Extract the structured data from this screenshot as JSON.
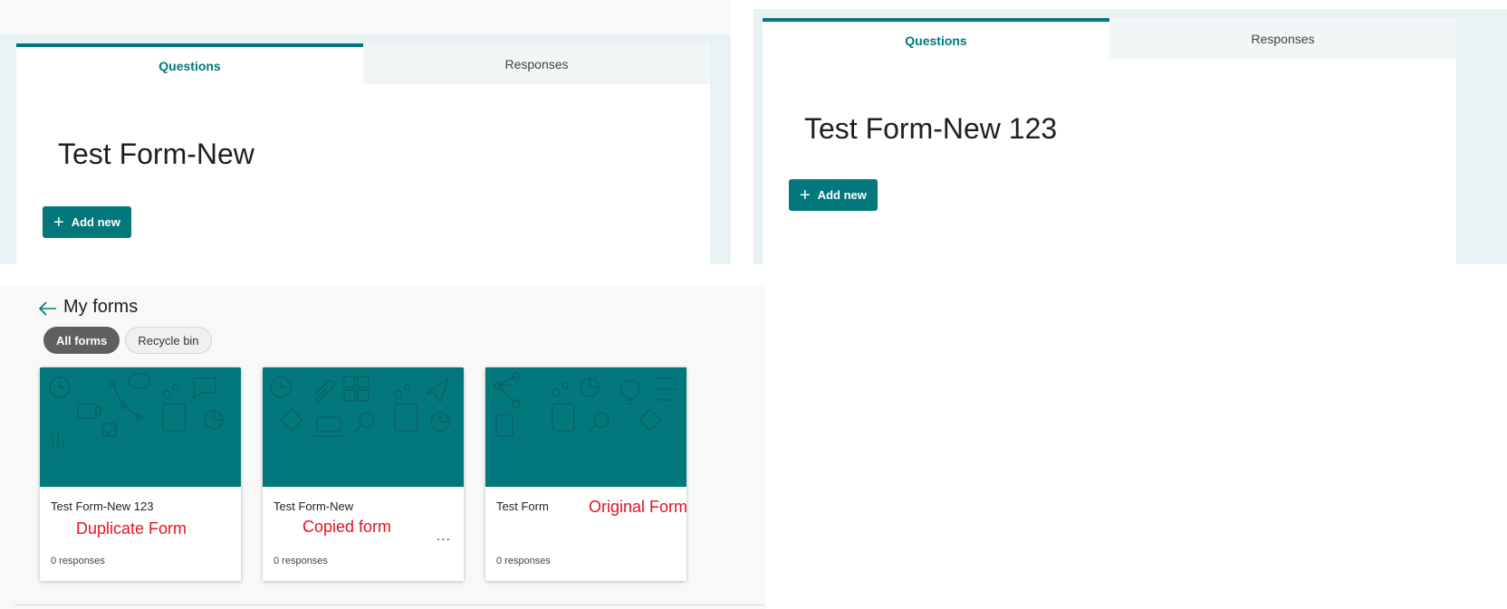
{
  "editor_left": {
    "tabs": [
      {
        "label": "Questions",
        "active": true
      },
      {
        "label": "Responses",
        "active": false
      }
    ],
    "form_title": "Test Form-New",
    "add_new_label": "Add new"
  },
  "editor_right": {
    "tabs": [
      {
        "label": "Questions",
        "active": true
      },
      {
        "label": "Responses",
        "active": false
      }
    ],
    "form_title": "Test Form-New 123",
    "add_new_label": "Add new"
  },
  "my_forms": {
    "title": "My forms",
    "filters": [
      {
        "label": "All forms",
        "active": true
      },
      {
        "label": "Recycle bin",
        "active": false
      }
    ],
    "cards": [
      {
        "name": "Test Form-New 123",
        "responses": "0 responses",
        "annotation": "Duplicate Form"
      },
      {
        "name": "Test Form-New",
        "responses": "0 responses",
        "annotation": "Copied form",
        "more": "..."
      },
      {
        "name": "Test Form",
        "responses": "0 responses",
        "annotation": "Original Form"
      }
    ]
  },
  "colors": {
    "accent": "#03787c",
    "annotation": "#e81123",
    "pill_active": "#5f5f5f"
  },
  "icons": [
    "plus-icon",
    "back-arrow-icon",
    "more-options-icon"
  ]
}
